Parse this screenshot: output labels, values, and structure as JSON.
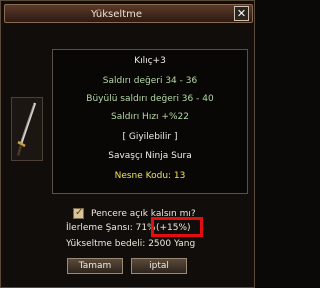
{
  "window": {
    "title": "Yükseltme",
    "close_glyph": "✕"
  },
  "item_icon": "katana-sword-icon",
  "tooltip": {
    "item_name": "Kılıç+3",
    "attack": "Saldırı değeri 34 - 36",
    "magic_attack": "Büyülü saldırı değeri 36 - 40",
    "attack_speed": "Saldırı Hızı +%22",
    "wearable": "[ Giyilebilir ]",
    "classes": "Savaşçı Ninja Sura",
    "item_code": "Nesne Kodu: 13"
  },
  "options": {
    "keep_window_open": "Pencere açık kalsın mı?",
    "keep_window_open_checked": true
  },
  "progress": {
    "chance_text": "İlerleme Şansı: 71%",
    "bonus_text": "(+15%)",
    "cost_text": "Yükseltme bedeli: 2500 Yang"
  },
  "buttons": {
    "ok": "Tamam",
    "cancel": "iptal"
  },
  "colors": {
    "highlight_border": "#e30f0f",
    "stat_green": "#b7d8a6",
    "code_yellow": "#f2e25d"
  }
}
